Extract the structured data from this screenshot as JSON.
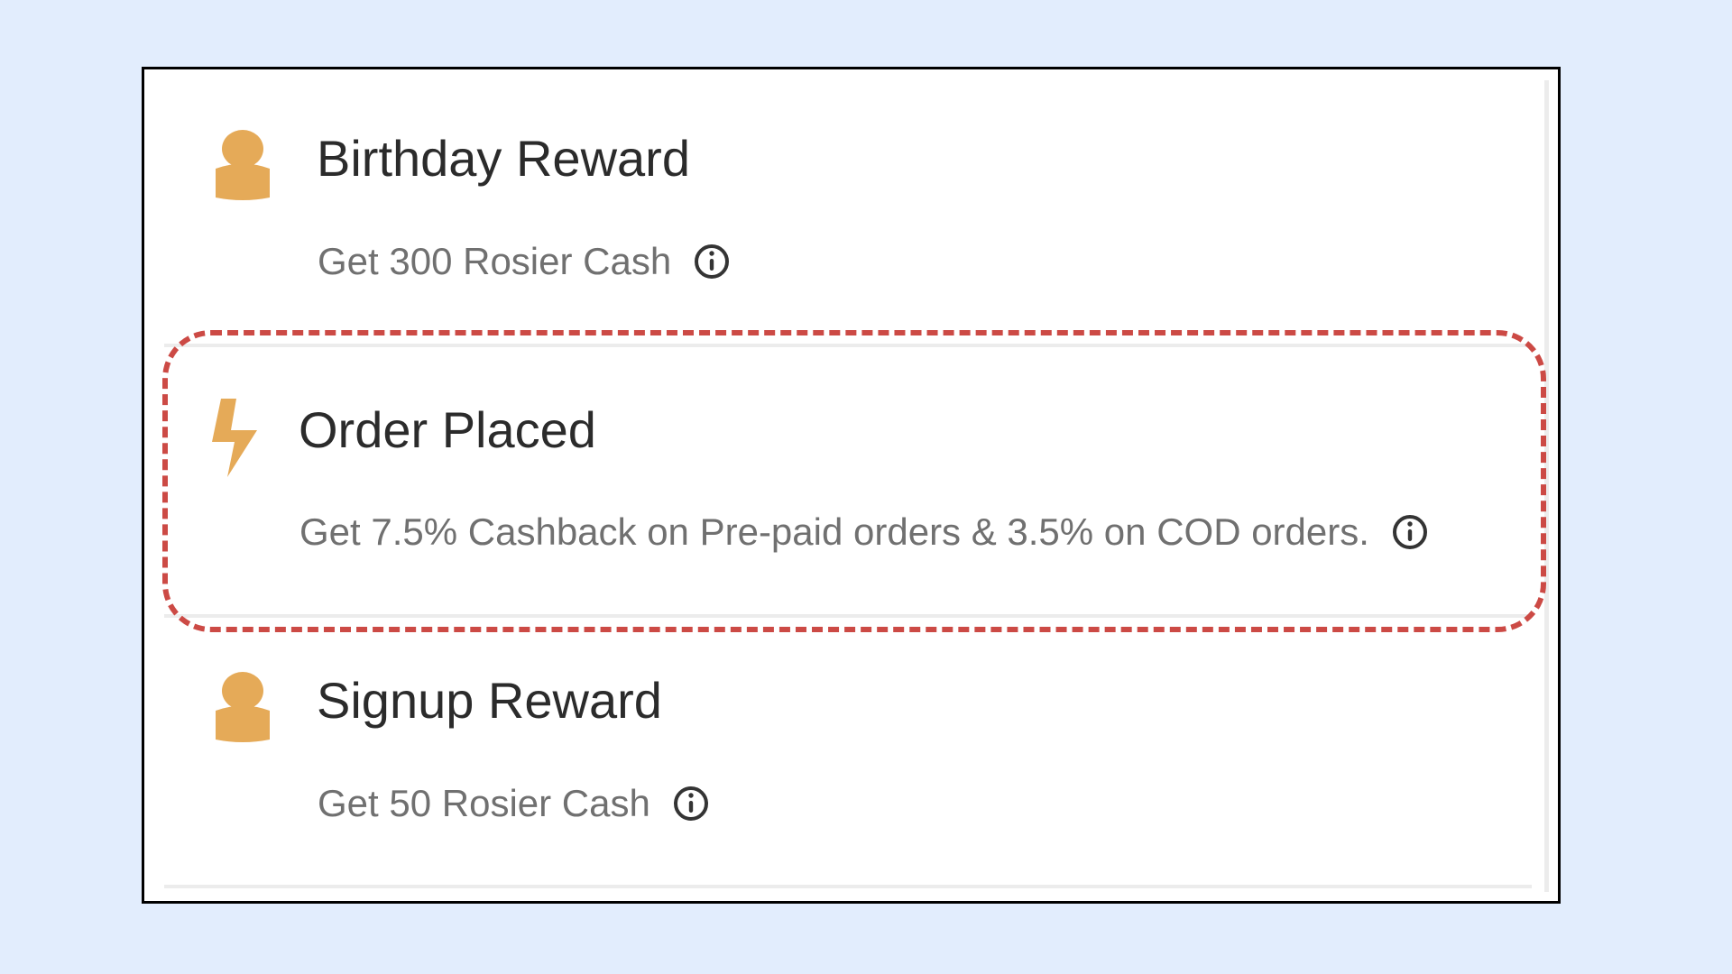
{
  "colors": {
    "page_background": "#e2edfd",
    "card_background": "#ffffff",
    "title_text": "#2b2b2b",
    "description_text": "#707070",
    "icon_orange": "#e5aa58",
    "highlight_red": "#cc4a45"
  },
  "rewards": [
    {
      "icon": "person-icon",
      "title": "Birthday Reward",
      "description": "Get 300 Rosier Cash",
      "info_icon": "info-icon"
    },
    {
      "icon": "lightning-icon",
      "title": "Order Placed",
      "description": "Get 7.5% Cashback on Pre-paid orders & 3.5% on COD orders.",
      "info_icon": "info-icon",
      "highlighted": true
    },
    {
      "icon": "person-icon",
      "title": "Signup Reward",
      "description": "Get 50 Rosier Cash",
      "info_icon": "info-icon"
    }
  ]
}
